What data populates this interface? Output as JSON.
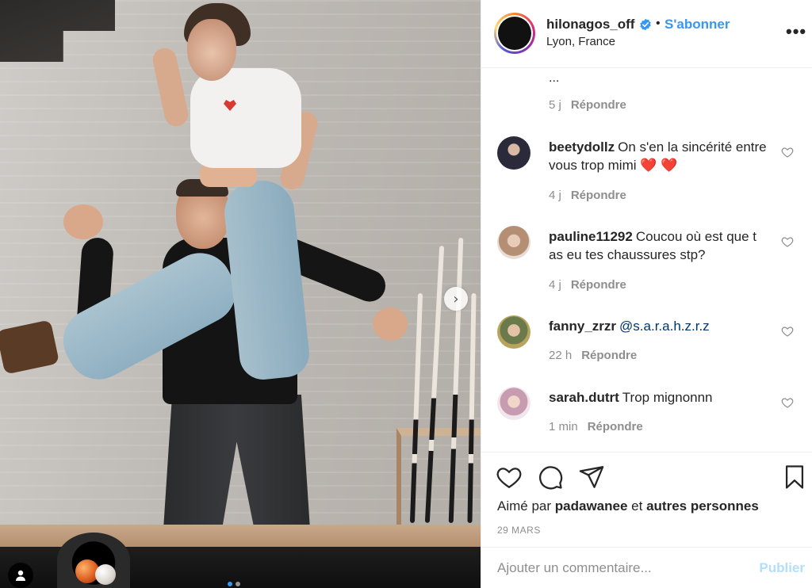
{
  "post": {
    "username": "hilonagos_off",
    "separator": "•",
    "follow_label": "S'abonner",
    "location": "Lyon, France",
    "more_label": "•••",
    "photo": {
      "next_icon": "chevron-right-icon",
      "user_tag_icon": "user-icon",
      "carousel_total": 2,
      "carousel_active": 1
    }
  },
  "caption_tail": {
    "text": "...",
    "time": "5 j",
    "reply_label": "Répondre"
  },
  "comments": [
    {
      "username": "beetydollz",
      "text": "On s'en la sincérité entre vous trop mimi ❤️ ❤️",
      "mention": "",
      "time": "4 j",
      "reply_label": "Répondre",
      "avatar_color": "#2a2a3a"
    },
    {
      "username": "pauline11292",
      "text": "Coucou où est que t as eu tes chaussures stp?",
      "mention": "",
      "time": "4 j",
      "reply_label": "Répondre",
      "avatar_color": "#c9a88f"
    },
    {
      "username": "fanny_zrzr",
      "text": "",
      "mention": "@s.a.r.a.h.z.r.z",
      "time": "22 h",
      "reply_label": "Répondre",
      "avatar_color": "#a58f52"
    },
    {
      "username": "sarah.dutrt",
      "text": "Trop mignonnn",
      "mention": "",
      "time": "1 min",
      "reply_label": "Répondre",
      "avatar_color": "#d4b8c8"
    }
  ],
  "actions": {
    "liked_prefix": "Aimé par",
    "liked_user": "padawanee",
    "liked_and": "et",
    "liked_others": "autres personnes",
    "date": "29 MARS"
  },
  "add_comment": {
    "placeholder": "Ajouter un commentaire...",
    "publish_label": "Publier"
  },
  "colors": {
    "accent": "#3897f0",
    "publish_disabled": "#b2dffc",
    "muted": "#8e8e8e",
    "text": "#262626"
  }
}
